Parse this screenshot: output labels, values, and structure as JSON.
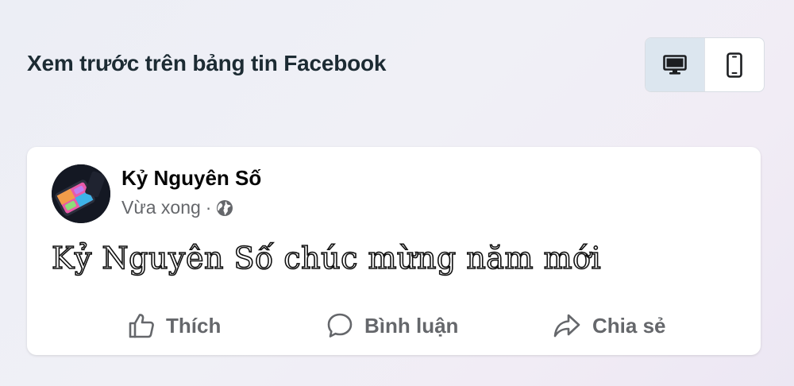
{
  "header": {
    "title": "Xem trước trên bảng tin Facebook"
  },
  "view_toggle": {
    "options": [
      {
        "icon": "desktop-icon",
        "active": true
      },
      {
        "icon": "mobile-icon",
        "active": false
      }
    ]
  },
  "post": {
    "author": "Kỷ Nguyên Số",
    "timestamp": "Vừa xong",
    "separator": "·",
    "privacy_icon": "globe-icon",
    "text": "Kỷ Nguyên Số chúc mừng năm mới"
  },
  "actions": {
    "like": "Thích",
    "comment": "Bình luận",
    "share": "Chia sẻ"
  },
  "colors": {
    "muted": "#65676b",
    "toggle_active": "#dce6ef"
  }
}
